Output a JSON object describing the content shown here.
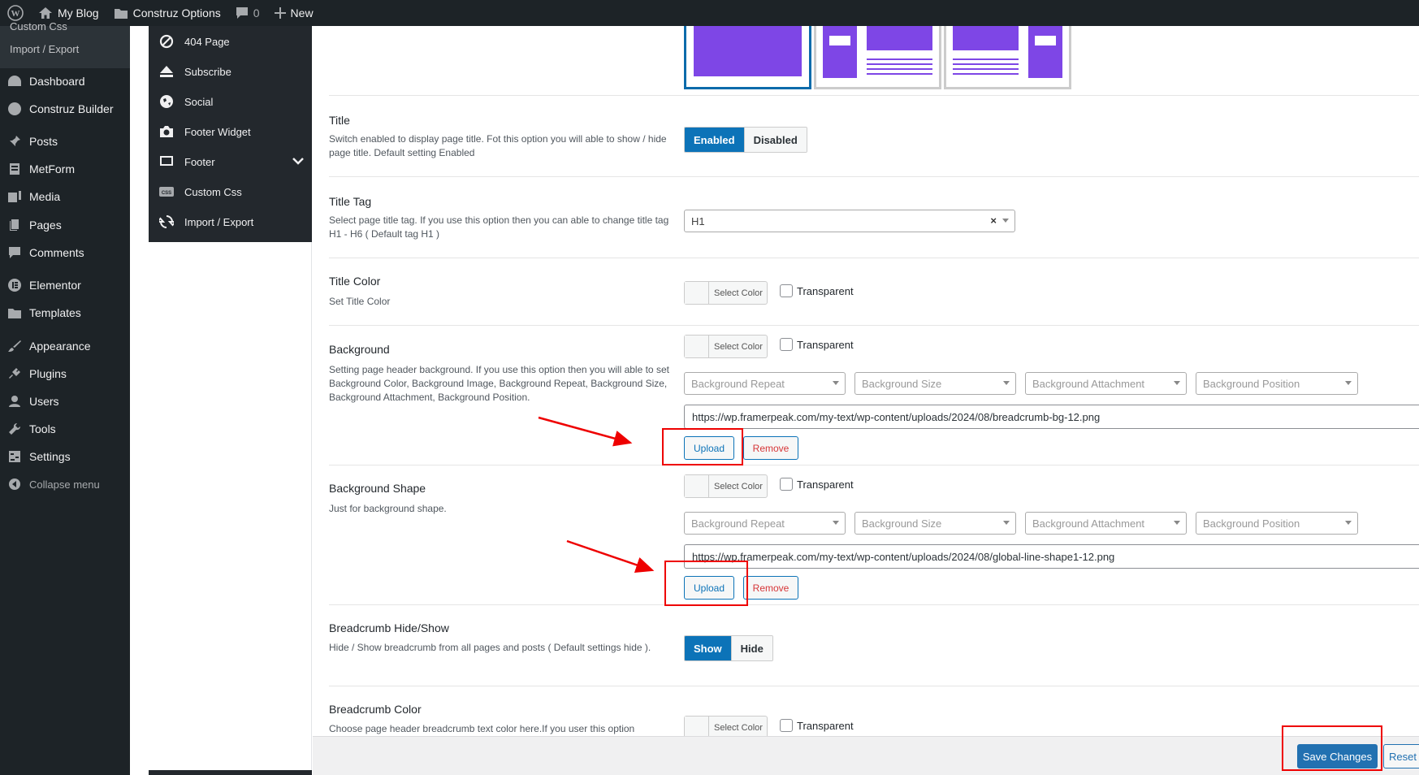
{
  "adminbar": {
    "site_name": "My Blog",
    "options_label": "Construz Options",
    "comments_count": "0",
    "new_label": "New"
  },
  "sidebar": {
    "submenu_partial": "Custom Css",
    "submenu_import": "Import / Export",
    "items": [
      {
        "label": "Dashboard",
        "icon": "dashboard-icon"
      },
      {
        "label": "Construz Builder",
        "icon": "globe-icon"
      },
      {
        "label": "Posts",
        "icon": "pin-icon"
      },
      {
        "label": "MetForm",
        "icon": "form-icon"
      },
      {
        "label": "Media",
        "icon": "media-icon"
      },
      {
        "label": "Pages",
        "icon": "pages-icon"
      },
      {
        "label": "Comments",
        "icon": "comment-icon"
      },
      {
        "label": "Elementor",
        "icon": "elementor-icon"
      },
      {
        "label": "Templates",
        "icon": "folder-icon"
      },
      {
        "label": "Appearance",
        "icon": "brush-icon"
      },
      {
        "label": "Plugins",
        "icon": "plug-icon"
      },
      {
        "label": "Users",
        "icon": "user-icon"
      },
      {
        "label": "Tools",
        "icon": "wrench-icon"
      },
      {
        "label": "Settings",
        "icon": "settings-icon"
      }
    ],
    "collapse": "Collapse menu"
  },
  "options_menu": {
    "items": [
      {
        "label": "404 Page",
        "icon": "ban-icon"
      },
      {
        "label": "Subscribe",
        "icon": "eject-icon"
      },
      {
        "label": "Social",
        "icon": "globe-icon"
      },
      {
        "label": "Footer Widget",
        "icon": "camera-icon"
      },
      {
        "label": "Footer",
        "icon": "monitor-icon"
      },
      {
        "label": "Custom Css",
        "icon": "css-icon"
      },
      {
        "label": "Import / Export",
        "icon": "refresh-icon"
      }
    ]
  },
  "sections": {
    "title": {
      "label": "Title",
      "desc": "Switch enabled to display page title. Fot this option you will able to show / hide page title. Default setting Enabled",
      "on": "Enabled",
      "off": "Disabled"
    },
    "title_tag": {
      "label": "Title Tag",
      "desc": "Select page title tag. If you use this option then you can able to change title tag H1 - H6 ( Default tag H1 )",
      "value": "H1",
      "clear": "×"
    },
    "title_color": {
      "label": "Title Color",
      "desc": "Set Title Color",
      "color_label": "Select Color",
      "transparent": "Transparent"
    },
    "background": {
      "label": "Background",
      "desc": "Setting page header background. If you use this option then you will able to set Background Color, Background Image, Background Repeat, Background Size, Background Attachment, Background Position.",
      "color_label": "Select Color",
      "transparent": "Transparent",
      "selects": [
        "Background Repeat",
        "Background Size",
        "Background Attachment",
        "Background Position"
      ],
      "url": "https://wp.framerpeak.com/my-text/wp-content/uploads/2024/08/breadcrumb-bg-12.png",
      "upload": "Upload",
      "remove": "Remove"
    },
    "background_shape": {
      "label": "Background Shape",
      "desc": "Just for background shape.",
      "color_label": "Select Color",
      "transparent": "Transparent",
      "selects": [
        "Background Repeat",
        "Background Size",
        "Background Attachment",
        "Background Position"
      ],
      "url": "https://wp.framerpeak.com/my-text/wp-content/uploads/2024/08/global-line-shape1-12.png",
      "upload": "Upload",
      "remove": "Remove"
    },
    "breadcrumb": {
      "label": "Breadcrumb Hide/Show",
      "desc": "Hide / Show breadcrumb from all pages and posts ( Default settings hide ).",
      "on": "Show",
      "off": "Hide"
    },
    "breadcrumb_color": {
      "label": "Breadcrumb Color",
      "desc": "Choose page header breadcrumb text color here.If you user this option",
      "color_label": "Select Color",
      "transparent": "Transparent"
    }
  },
  "footer": {
    "save": "Save Changes",
    "reset": "Reset S"
  },
  "colors": {
    "accent": "#2271b1",
    "layout_purple": "#7e46e6",
    "annotation_red": "#e00000"
  }
}
